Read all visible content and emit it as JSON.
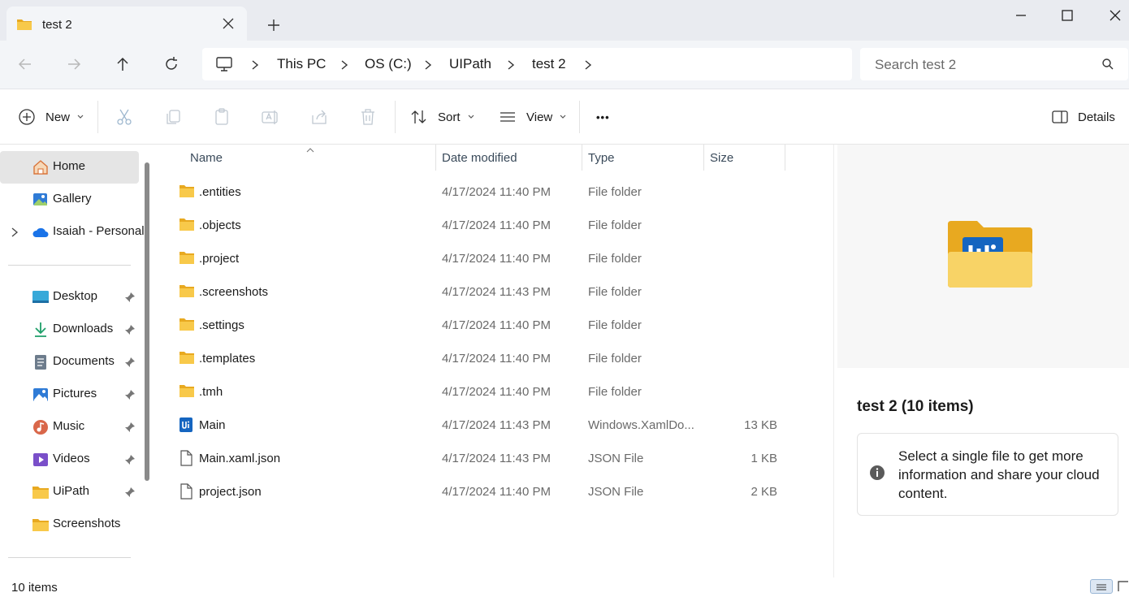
{
  "window": {
    "tab_title": "test 2",
    "new_tab_glyph": "+"
  },
  "nav": {
    "breadcrumbs": [
      "This PC",
      "OS (C:)",
      "UIPath",
      "test 2"
    ],
    "search_placeholder": "Search test 2"
  },
  "toolbar": {
    "new_label": "New",
    "sort_label": "Sort",
    "view_label": "View",
    "more_label": "•••",
    "details_label": "Details"
  },
  "sidebar": {
    "top_items": [
      {
        "label": "Home",
        "icon": "home-icon",
        "active": true
      },
      {
        "label": "Gallery",
        "icon": "gallery-icon"
      },
      {
        "label": "Isaiah - Personal",
        "icon": "onedrive-icon",
        "expandable": true
      }
    ],
    "quick_access": [
      {
        "label": "Desktop",
        "icon": "desktop-icon",
        "pinned": true
      },
      {
        "label": "Downloads",
        "icon": "downloads-icon",
        "pinned": true
      },
      {
        "label": "Documents",
        "icon": "documents-icon",
        "pinned": true
      },
      {
        "label": "Pictures",
        "icon": "pictures-icon",
        "pinned": true
      },
      {
        "label": "Music",
        "icon": "music-icon",
        "pinned": true
      },
      {
        "label": "Videos",
        "icon": "videos-icon",
        "pinned": true
      },
      {
        "label": "UiPath",
        "icon": "folder-icon",
        "pinned": true
      },
      {
        "label": "Screenshots",
        "icon": "folder-icon",
        "pinned": false
      }
    ]
  },
  "columns": {
    "name": "Name",
    "date": "Date modified",
    "type": "Type",
    "size": "Size"
  },
  "files": [
    {
      "name": ".entities",
      "date": "4/17/2024 11:40 PM",
      "type": "File folder",
      "size": "",
      "icon": "folder-icon"
    },
    {
      "name": ".objects",
      "date": "4/17/2024 11:40 PM",
      "type": "File folder",
      "size": "",
      "icon": "folder-icon"
    },
    {
      "name": ".project",
      "date": "4/17/2024 11:40 PM",
      "type": "File folder",
      "size": "",
      "icon": "folder-icon"
    },
    {
      "name": ".screenshots",
      "date": "4/17/2024 11:43 PM",
      "type": "File folder",
      "size": "",
      "icon": "folder-icon"
    },
    {
      "name": ".settings",
      "date": "4/17/2024 11:40 PM",
      "type": "File folder",
      "size": "",
      "icon": "folder-icon"
    },
    {
      "name": ".templates",
      "date": "4/17/2024 11:40 PM",
      "type": "File folder",
      "size": "",
      "icon": "folder-icon"
    },
    {
      "name": ".tmh",
      "date": "4/17/2024 11:40 PM",
      "type": "File folder",
      "size": "",
      "icon": "folder-icon"
    },
    {
      "name": "Main",
      "date": "4/17/2024 11:43 PM",
      "type": "Windows.XamlDo...",
      "size": "13 KB",
      "icon": "uipath-xaml-icon"
    },
    {
      "name": "Main.xaml.json",
      "date": "4/17/2024 11:43 PM",
      "type": "JSON File",
      "size": "1 KB",
      "icon": "file-icon"
    },
    {
      "name": "project.json",
      "date": "4/17/2024 11:40 PM",
      "type": "JSON File",
      "size": "2 KB",
      "icon": "file-icon"
    }
  ],
  "details": {
    "title": "test 2 (10 items)",
    "info_text": "Select a single file to get more information and share your cloud content."
  },
  "status": {
    "item_count": "10 items"
  },
  "colors": {
    "folder": "#f8c94a",
    "folder_dark": "#e8a920",
    "uipath_blue": "#1565c0",
    "accent": "#0067c0"
  }
}
